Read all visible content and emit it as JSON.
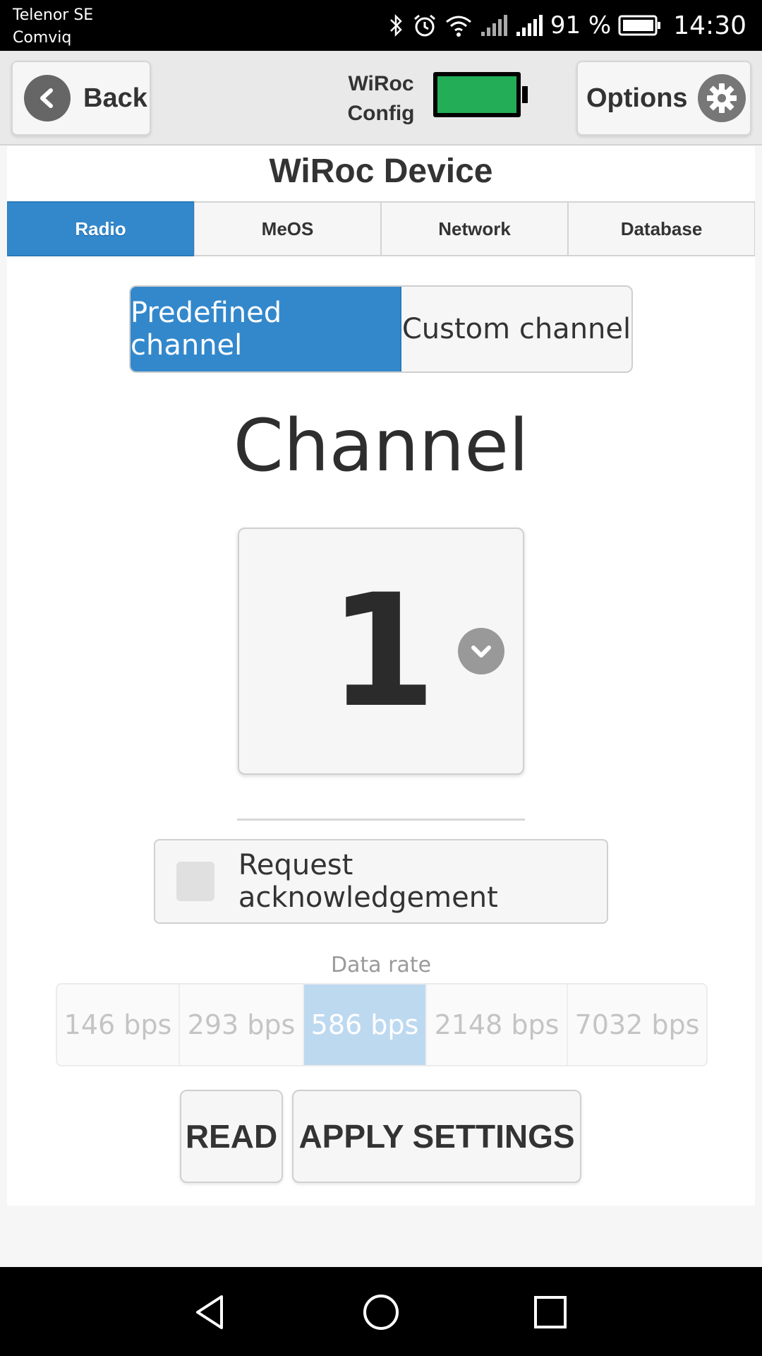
{
  "status_bar": {
    "carrier_line1": "Telenor SE",
    "carrier_line2": "Comviq",
    "battery_percent": "91 %",
    "time": "14:30",
    "icons": [
      "bluetooth-icon",
      "alarm-icon",
      "wifi-icon",
      "signal-icon",
      "signal-icon",
      "battery-icon"
    ]
  },
  "header": {
    "back_label": "Back",
    "title_line1": "WiRoc",
    "title_line2": "Config",
    "options_label": "Options",
    "device_battery_color": "#24ad57"
  },
  "page": {
    "title": "WiRoc Device"
  },
  "tabs": [
    {
      "label": "Radio",
      "active": true
    },
    {
      "label": "MeOS",
      "active": false
    },
    {
      "label": "Network",
      "active": false
    },
    {
      "label": "Database",
      "active": false
    }
  ],
  "channel_mode": {
    "options": [
      "Predefined channel",
      "Custom channel"
    ],
    "selected": "Predefined channel"
  },
  "channel": {
    "heading": "Channel",
    "value": "1"
  },
  "acknowledgement": {
    "label": "Request acknowledgement",
    "checked": false
  },
  "data_rate": {
    "label": "Data rate",
    "options": [
      "146 bps",
      "293 bps",
      "586 bps",
      "2148 bps",
      "7032 bps"
    ],
    "selected": "586 bps"
  },
  "actions": {
    "read_label": "READ",
    "apply_label": "APPLY SETTINGS"
  },
  "colors": {
    "accent": "#3388cc",
    "selected_rate": "#bdd9f0"
  }
}
